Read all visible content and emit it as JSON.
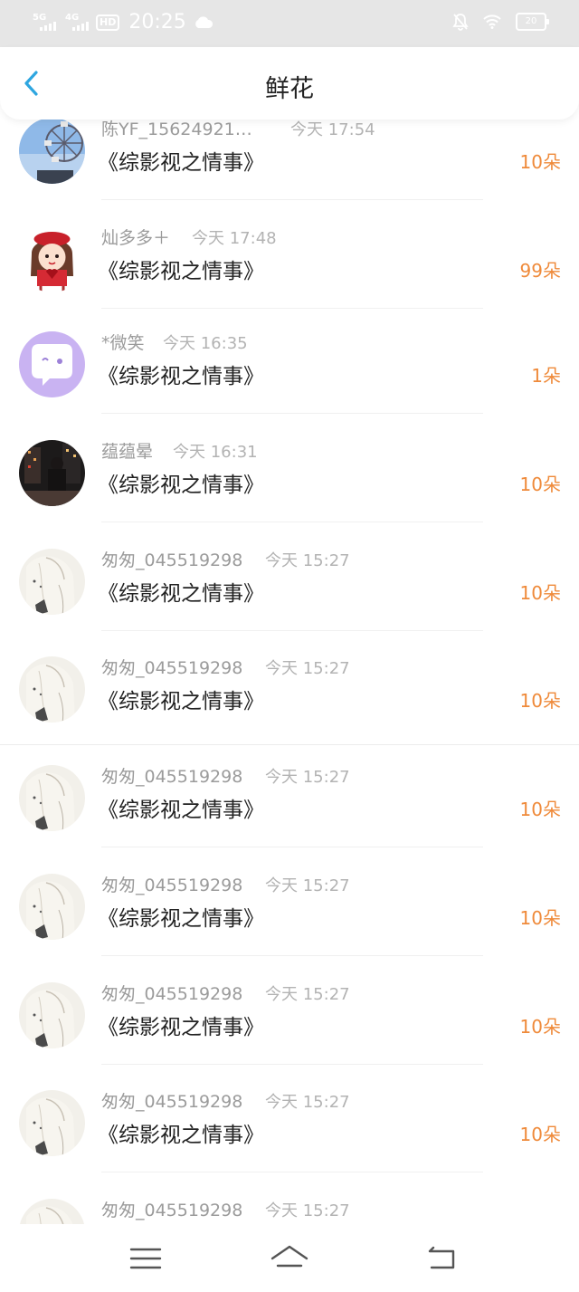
{
  "status_bar": {
    "net1_label": "5G",
    "net2_label": "4G",
    "hd_label": "HD",
    "time": "20:25",
    "battery": "20"
  },
  "header": {
    "title": "鲜花"
  },
  "colors": {
    "accent": "#2ea6e0",
    "count": "#ef8a3a",
    "name": "#9b9b9b",
    "time": "#b3b3b3",
    "title": "#222222"
  },
  "items": [
    {
      "name": "陈YF_15624921…",
      "time": "今天 17:54",
      "work": "《综影视之情事》",
      "count": "10朵",
      "avatar": "ferris-wheel-photo"
    },
    {
      "name": "灿多多＋",
      "time": "今天 17:48",
      "work": "《综影视之情事》",
      "count": "99朵",
      "avatar": "cartoon-girl"
    },
    {
      "name": "*微笑",
      "time": "今天 16:35",
      "work": "《综影视之情事》",
      "count": "1朵",
      "avatar": "chat-bubble-default"
    },
    {
      "name": "蕴蕴晕",
      "time": "今天 16:31",
      "work": "《综影视之情事》",
      "count": "10朵",
      "avatar": "night-city-photo"
    },
    {
      "name": "匆匆_045519298",
      "time": "今天 15:27",
      "work": "《综影视之情事》",
      "count": "10朵",
      "avatar": "light-sketch"
    },
    {
      "name": "匆匆_045519298",
      "time": "今天 15:27",
      "work": "《综影视之情事》",
      "count": "10朵",
      "avatar": "light-sketch"
    },
    {
      "name": "匆匆_045519298",
      "time": "今天 15:27",
      "work": "《综影视之情事》",
      "count": "10朵",
      "avatar": "light-sketch"
    },
    {
      "name": "匆匆_045519298",
      "time": "今天 15:27",
      "work": "《综影视之情事》",
      "count": "10朵",
      "avatar": "light-sketch"
    },
    {
      "name": "匆匆_045519298",
      "time": "今天 15:27",
      "work": "《综影视之情事》",
      "count": "10朵",
      "avatar": "light-sketch"
    },
    {
      "name": "匆匆_045519298",
      "time": "今天 15:27",
      "work": "《综影视之情事》",
      "count": "10朵",
      "avatar": "light-sketch"
    },
    {
      "name": "匆匆_045519298",
      "time": "今天 15:27",
      "work": "",
      "count": "",
      "avatar": "light-sketch"
    }
  ],
  "nav": {
    "menu_icon": "menu-icon",
    "home_icon": "home-icon",
    "back_icon": "return-icon"
  }
}
